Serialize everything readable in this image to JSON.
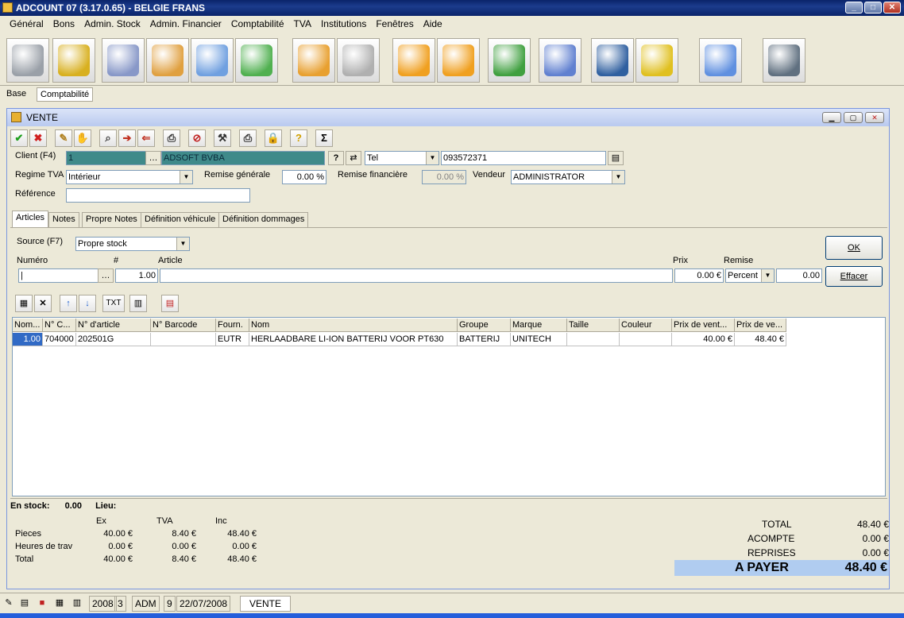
{
  "app": {
    "title": "ADCOUNT 07 (3.17.0.65)  - BELGIE FRANS"
  },
  "menu": [
    "Général",
    "Bons",
    "Admin. Stock",
    "Admin. Financier",
    "Comptabilité",
    "TVA",
    "Institutions",
    "Fenêtres",
    "Aide"
  ],
  "toolbar_icons": [
    {
      "name": "shopping-cart-icon",
      "color": "#9aa0a8"
    },
    {
      "name": "coins-icon",
      "color": "#d8b020"
    },
    {
      "name": "gear-icon",
      "color": "#8898c8"
    },
    {
      "name": "monitor-gear-icon",
      "color": "#e0a040"
    },
    {
      "name": "monitor-bulb-icon",
      "color": "#70a0e0"
    },
    {
      "name": "book-icon",
      "color": "#50b050"
    },
    {
      "name": "box-icon",
      "color": "#e8a030"
    },
    {
      "name": "keys-icon",
      "color": "#b0b0b0"
    },
    {
      "name": "import-arrow-icon",
      "color": "#f0a020"
    },
    {
      "name": "export-arrow-icon",
      "color": "#f0a020"
    },
    {
      "name": "download-folder-icon",
      "color": "#40a040"
    },
    {
      "name": "update-window-icon",
      "color": "#6080d0"
    },
    {
      "name": "user-icon",
      "color": "#3060a0"
    },
    {
      "name": "truck-icon",
      "color": "#e0c020"
    },
    {
      "name": "lightbulb-icon",
      "color": "#6090e0"
    },
    {
      "name": "key-lock-icon",
      "color": "#607080"
    }
  ],
  "top_tabs": {
    "base": "Base",
    "compta": "Comptabilité"
  },
  "vente": {
    "title": "VENTE",
    "client_label": "Client (F4)",
    "client_id": "1",
    "client_name": "ADSOFT BVBA",
    "contact_type": "Tel",
    "contact_value": "093572371",
    "regime_label": "Regime TVA",
    "regime_value": "Intérieur",
    "remise_gen_label": "Remise générale",
    "remise_gen_value": "0.00 %",
    "remise_fin_label": "Remise financière",
    "remise_fin_value": "0.00 %",
    "vendeur_label": "Vendeur",
    "vendeur_value": "ADMINISTRATOR",
    "reference_label": "Référence",
    "tabs": [
      "Articles",
      "Notes",
      "Propre Notes",
      "Définition véhicule",
      "Définition dommages"
    ],
    "source_label": "Source (F7)",
    "source_value": "Propre stock",
    "numero_label": "Numéro",
    "qty_label": "#",
    "qty_value": "1.00",
    "article_label": "Article",
    "prix_label": "Prix",
    "prix_value": "0.00 €",
    "remise_label": "Remise",
    "remise_type": "Percent",
    "remise_value": "0.00",
    "ok_label": "OK",
    "effacer_label": "Effacer",
    "txt_label": "TXT"
  },
  "grid": {
    "headers": [
      "Nom...",
      "N° C...",
      "N° d'article",
      "N° Barcode",
      "Fourn.",
      "Nom",
      "Groupe",
      "Marque",
      "Taille",
      "Couleur",
      "Prix de vent...",
      "Prix de ve..."
    ],
    "rows": [
      [
        "1.00",
        "704000",
        "202501G",
        "",
        "EUTR",
        "HERLAADBARE LI-ION BATTERIJ VOOR PT630",
        "BATTERIJ",
        "UNITECH",
        "",
        "",
        "40.00 €",
        "48.40 €"
      ]
    ]
  },
  "stock": {
    "label": "En stock:",
    "value": "0.00",
    "lieu_label": "Lieu:"
  },
  "totals": {
    "col_ex": "Ex",
    "col_tva": "TVA",
    "col_inc": "Inc",
    "rows": [
      {
        "label": "Pieces",
        "ex": "40.00 €",
        "tva": "8.40 €",
        "inc": "48.40 €"
      },
      {
        "label": "Heures de trav",
        "ex": "0.00 €",
        "tva": "0.00 €",
        "inc": "0.00 €"
      },
      {
        "label": "Total",
        "ex": "40.00 €",
        "tva": "8.40 €",
        "inc": "48.40 €"
      }
    ],
    "total_label": "TOTAL",
    "total_value": "48.40 €",
    "acompte_label": "ACOMPTE",
    "acompte_value": "0.00 €",
    "reprises_label": "REPRISES",
    "reprises_value": "0.00 €",
    "apayer_label": "A PAYER",
    "apayer_value": "48.40 €"
  },
  "status": {
    "year": "2008",
    "num": "3",
    "user": "ADM",
    "count": "9",
    "date": "22/07/2008",
    "window": "VENTE"
  }
}
